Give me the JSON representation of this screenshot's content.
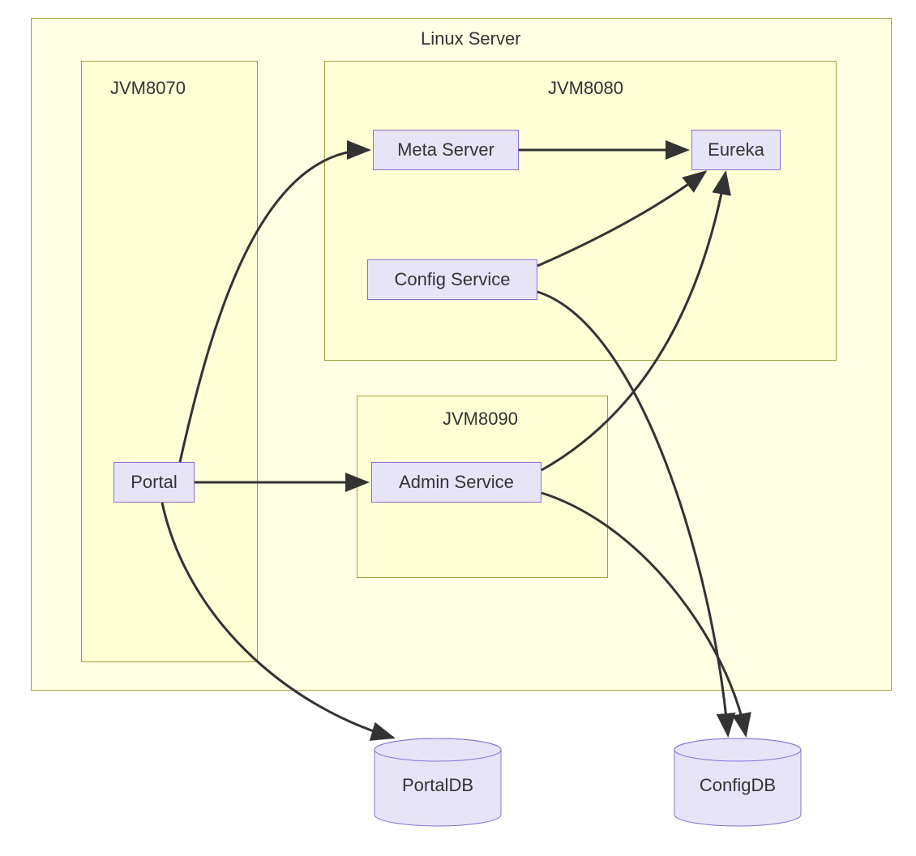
{
  "containers": {
    "linux_server": {
      "label": "Linux Server"
    },
    "jvm8070": {
      "label": "JVM8070"
    },
    "jvm8080": {
      "label": "JVM8080"
    },
    "jvm8090": {
      "label": "JVM8090"
    }
  },
  "nodes": {
    "portal": {
      "label": "Portal"
    },
    "meta_server": {
      "label": "Meta Server"
    },
    "config_service": {
      "label": "Config Service"
    },
    "eureka": {
      "label": "Eureka"
    },
    "admin_service": {
      "label": "Admin Service"
    }
  },
  "databases": {
    "portal_db": {
      "label": "PortalDB"
    },
    "config_db": {
      "label": "ConfigDB"
    }
  },
  "edges": [
    {
      "from": "portal",
      "to": "meta_server"
    },
    {
      "from": "portal",
      "to": "admin_service"
    },
    {
      "from": "portal",
      "to": "portal_db"
    },
    {
      "from": "meta_server",
      "to": "eureka"
    },
    {
      "from": "config_service",
      "to": "eureka"
    },
    {
      "from": "config_service",
      "to": "config_db"
    },
    {
      "from": "admin_service",
      "to": "eureka"
    },
    {
      "from": "admin_service",
      "to": "config_db"
    }
  ]
}
